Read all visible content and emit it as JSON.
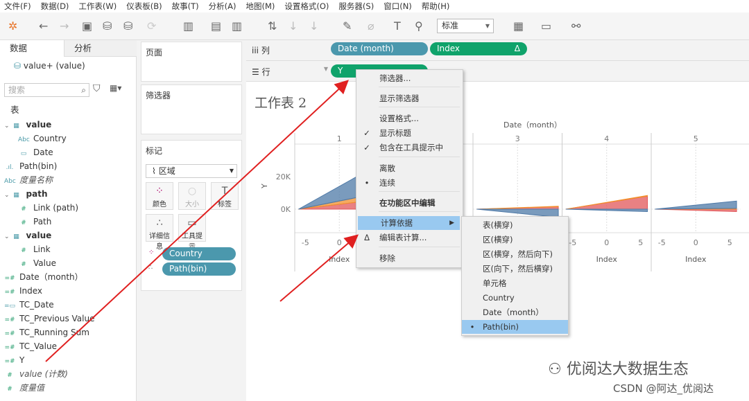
{
  "menubar": [
    "文件(F)",
    "数据(D)",
    "工作表(W)",
    "仪表板(B)",
    "故事(T)",
    "分析(A)",
    "地图(M)",
    "设置格式(O)",
    "服务器(S)",
    "窗口(N)",
    "帮助(H)"
  ],
  "toolbar": {
    "fit_select": "标准"
  },
  "left": {
    "tabs": [
      "数据",
      "分析"
    ],
    "datasource": "value+ (value)",
    "search_placeholder": "搜索",
    "section": "表",
    "fields": [
      {
        "label": "value",
        "icon": "table-icon",
        "bold": true,
        "indent": 0
      },
      {
        "label": "Country",
        "icon": "Abc",
        "indent": 1
      },
      {
        "label": "Date",
        "icon": "calendar-icon",
        "indent": 1
      },
      {
        "label": "Path(bin)",
        "icon": "bin-icon",
        "indent": 0
      },
      {
        "label": "度量名称",
        "icon": "Abc",
        "indent": 0,
        "italic": true
      },
      {
        "label": "path",
        "icon": "table-icon",
        "bold": true,
        "indent": 0
      },
      {
        "label": "Link (path)",
        "icon": "#",
        "indent": 1
      },
      {
        "label": "Path",
        "icon": "#",
        "indent": 1
      },
      {
        "label": "value",
        "icon": "table-icon",
        "bold": true,
        "indent": 0
      },
      {
        "label": "Link",
        "icon": "#",
        "indent": 1
      },
      {
        "label": "Value",
        "icon": "#",
        "indent": 1
      },
      {
        "label": "Date（month）",
        "icon": "=#",
        "indent": 0
      },
      {
        "label": "Index",
        "icon": "=#",
        "indent": 0
      },
      {
        "label": "TC_Date",
        "icon": "=date",
        "indent": 0
      },
      {
        "label": "TC_Previous Value",
        "icon": "=#",
        "indent": 0
      },
      {
        "label": "TC_Running Sum",
        "icon": "=#",
        "indent": 0
      },
      {
        "label": "TC_Value",
        "icon": "=#",
        "indent": 0
      },
      {
        "label": "Y",
        "icon": "=#",
        "indent": 0
      },
      {
        "label": "value (计数)",
        "icon": "#",
        "indent": 0,
        "italic": true
      },
      {
        "label": "度量值",
        "icon": "#",
        "indent": 0,
        "italic": true
      }
    ]
  },
  "cards": {
    "pages": "页面",
    "filters": "筛选器",
    "marks": "标记",
    "mark_type": "区域",
    "buttons": [
      "颜色",
      "大小",
      "标签",
      "详细信息",
      "工具提示"
    ],
    "pills": [
      "Country",
      "Path(bin)"
    ]
  },
  "shelves": {
    "columns_label": "列",
    "rows_label": "行",
    "columns": [
      "Date (month)",
      "Index"
    ],
    "rows": [
      "Y"
    ]
  },
  "view": {
    "title": "工作表 2",
    "header": "Date（month）",
    "months": [
      "1",
      "3",
      "4",
      "5"
    ],
    "y_label": "Y",
    "y_ticks": [
      "20K",
      "0K"
    ],
    "x_ticks": [
      "-5",
      "0",
      "5"
    ],
    "x_label": "Index"
  },
  "chart_data": {
    "type": "area",
    "colors": {
      "blue": "#4e79a7",
      "orange": "#f28e2b",
      "red": "#e15759"
    },
    "panes": [
      {
        "month": "1",
        "series": {
          "red": 6000,
          "orange": 4000,
          "blue": 18000
        }
      },
      {
        "month": "3",
        "series": {
          "red": 1500,
          "orange": 300,
          "blue": -5000
        }
      },
      {
        "month": "4",
        "series": {
          "red": 8000,
          "orange": 400,
          "blue": -1500
        }
      },
      {
        "month": "5",
        "series": {
          "red": -1500,
          "orange": 500,
          "blue": 4500
        }
      }
    ]
  },
  "context_menu": {
    "items": [
      "筛选器...",
      "显示筛选器",
      "设置格式...",
      "显示标题",
      "包含在工具提示中",
      "离散",
      "连续",
      "在功能区中编辑",
      "计算依据",
      "编辑表计算...",
      "移除"
    ]
  },
  "submenu": {
    "items": [
      "表(横穿)",
      "区(横穿)",
      "区(横穿，然后向下)",
      "区(向下，然后横穿)",
      "单元格",
      "Country",
      "Date（month）",
      "Path(bin)"
    ],
    "selected": "Path(bin)"
  },
  "watermark": {
    "line1": "优阅达大数据生态",
    "line2": "CSDN @阿达_优阅达"
  }
}
